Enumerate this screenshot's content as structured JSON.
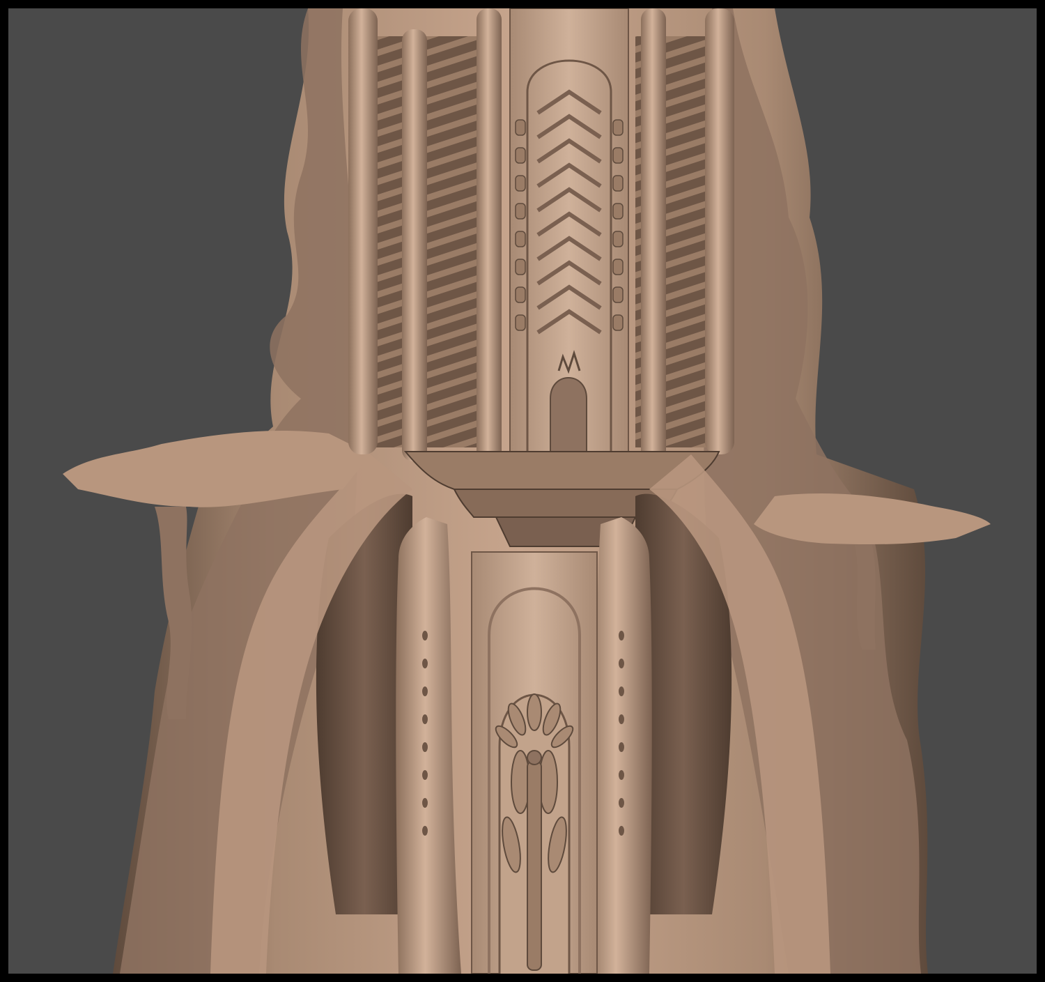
{
  "scene": {
    "subject": "sculpted-tree-tower",
    "colors": {
      "frame": "#000000",
      "background": "#4a4a4a",
      "clay_light": "#c7a58d",
      "clay_mid": "#a98a73",
      "clay_dark": "#6e5646",
      "clay_shadow": "#4e3c30"
    }
  }
}
